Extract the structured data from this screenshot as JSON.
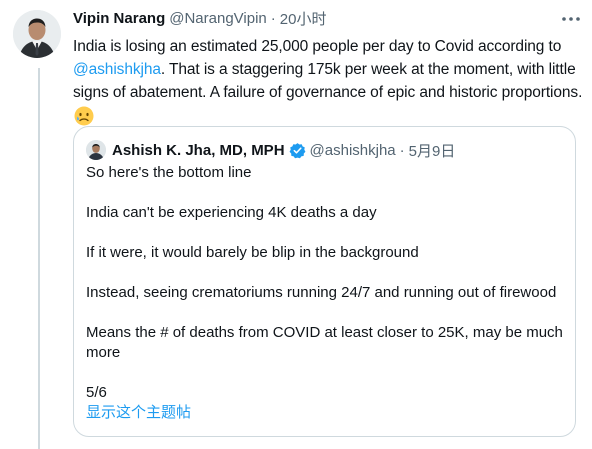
{
  "tweet": {
    "author_name": "Vipin Narang",
    "author_handle": "@NarangVipin",
    "separator": "·",
    "time": "20小时",
    "text_line1": "India is losing an estimated 25,000 people per day to Covid according to",
    "mention": "@ashishkjha",
    "text_line2_rest": ". That is a staggering 175k per week at the moment, with little",
    "text_line3": "signs of abatement. A failure of governance of epic and historic proportions."
  },
  "quote": {
    "author_name": "Ashish K. Jha, MD, MPH",
    "author_handle": "@ashishkjha",
    "separator": "·",
    "date": "5月9日",
    "lines": [
      "So here's the bottom line",
      "",
      "India can't be experiencing 4K deaths a day",
      "",
      "If it were, it would barely be blip in the background",
      "",
      "Instead, seeing crematoriums running 24/7 and running out of firewood",
      "",
      "Means the # of deaths from COVID at least closer to 25K, may be much",
      "more",
      "",
      "5/6"
    ],
    "show_thread": "显示这个主题帖"
  },
  "icons": {
    "more": "more-dots-icon",
    "verified": "verified-badge-icon",
    "emoji": "crying-face-emoji"
  },
  "colors": {
    "link": "#1d9bf0",
    "muted": "#536471",
    "border": "#cfd9de",
    "verified": "#1d9bf0"
  }
}
